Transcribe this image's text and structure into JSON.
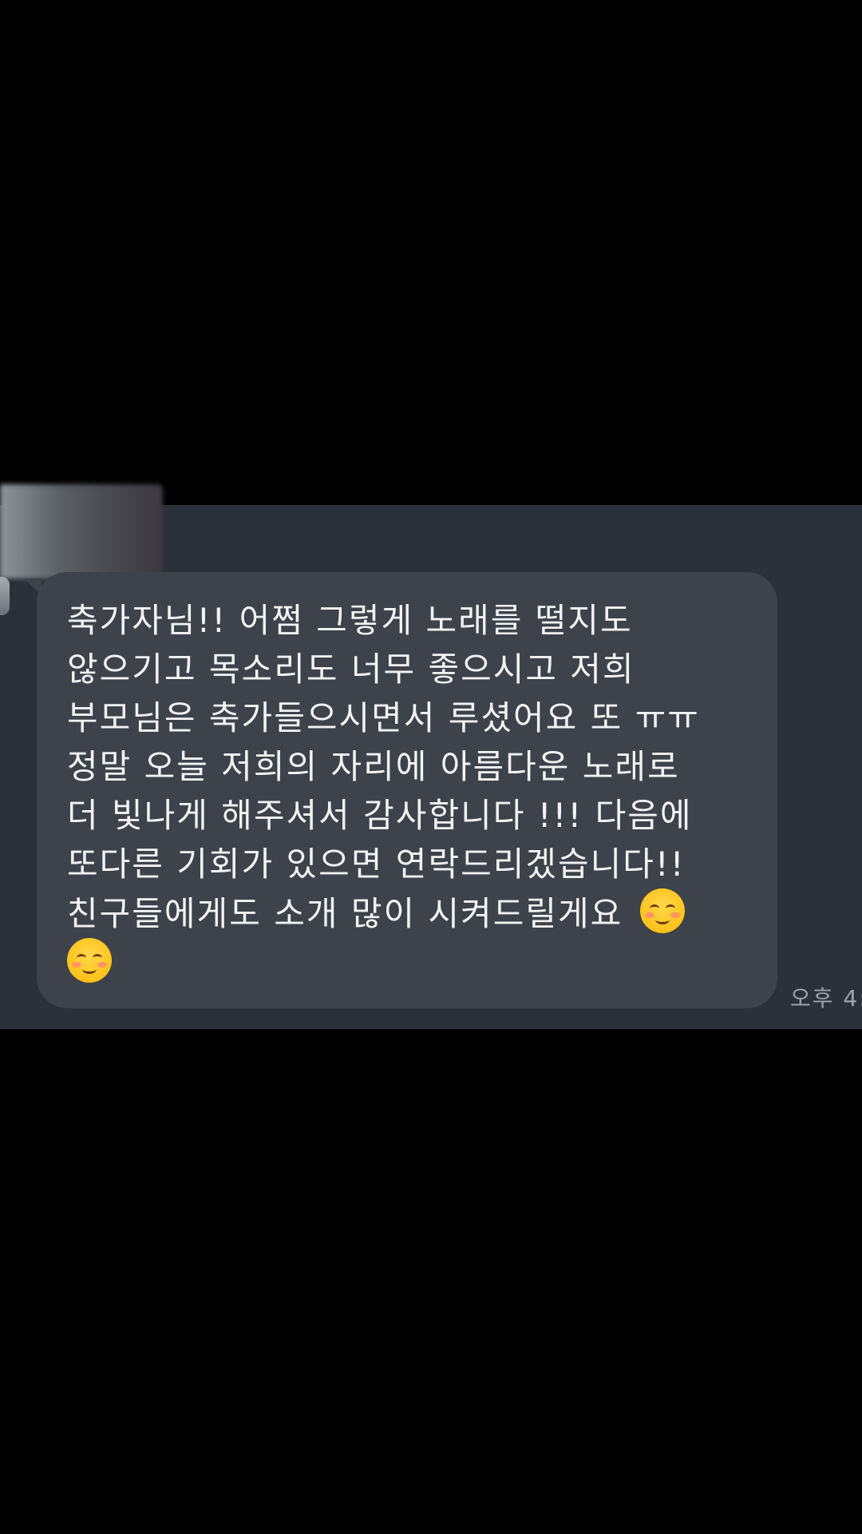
{
  "chat": {
    "message_lines": [
      "축가자님!! 어쩜 그렇게 노래를 떨지도",
      "않으기고 목소리도 너무 좋으시고 저희",
      "부모님은 축가들으시면서 루셨어요 또 ㅠㅠ",
      "정말 오늘 저희의 자리에 아름다운 노래로",
      "더 빛나게 해주셔서 감사합니다 !!! 다음에",
      "또다른 기회가 있으면 연락드리겠습니다!!",
      "친구들에게도 소개 많이 시켜드릴게요"
    ],
    "emoji_icon": "smiling-face-with-blush-emoji",
    "timestamp": "오후 4:"
  },
  "colors": {
    "background": "#000000",
    "chat_panel": "#2c3038",
    "bubble": "#3d424b",
    "text": "#f1f2f4",
    "timestamp": "#9ea3ab"
  }
}
